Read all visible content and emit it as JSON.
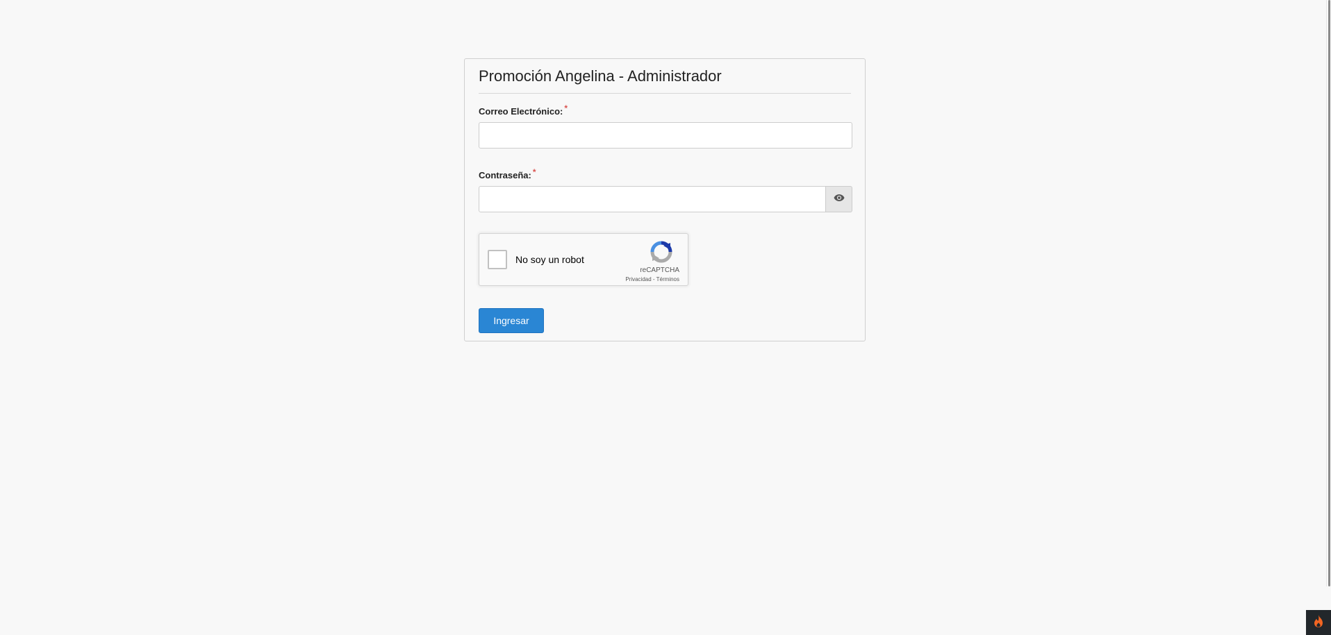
{
  "login": {
    "title": "Promoción Angelina - Administrador",
    "email_label": "Correo Electrónico:",
    "email_value": "",
    "password_label": "Contraseña:",
    "password_value": "",
    "required_mark": "*",
    "submit_label": "Ingresar"
  },
  "captcha": {
    "label": "No soy un robot",
    "brand": "reCAPTCHA",
    "privacy": "Privacidad",
    "separator": " - ",
    "terms": "Términos"
  },
  "icons": {
    "password_toggle": "eye-icon",
    "captcha_logo": "recaptcha-logo-icon",
    "corner_widget": "flame-icon"
  },
  "colors": {
    "primary": "#2a86d4",
    "required": "#d9534f",
    "corner_widget": "#22272b",
    "flame": "#f26522"
  }
}
